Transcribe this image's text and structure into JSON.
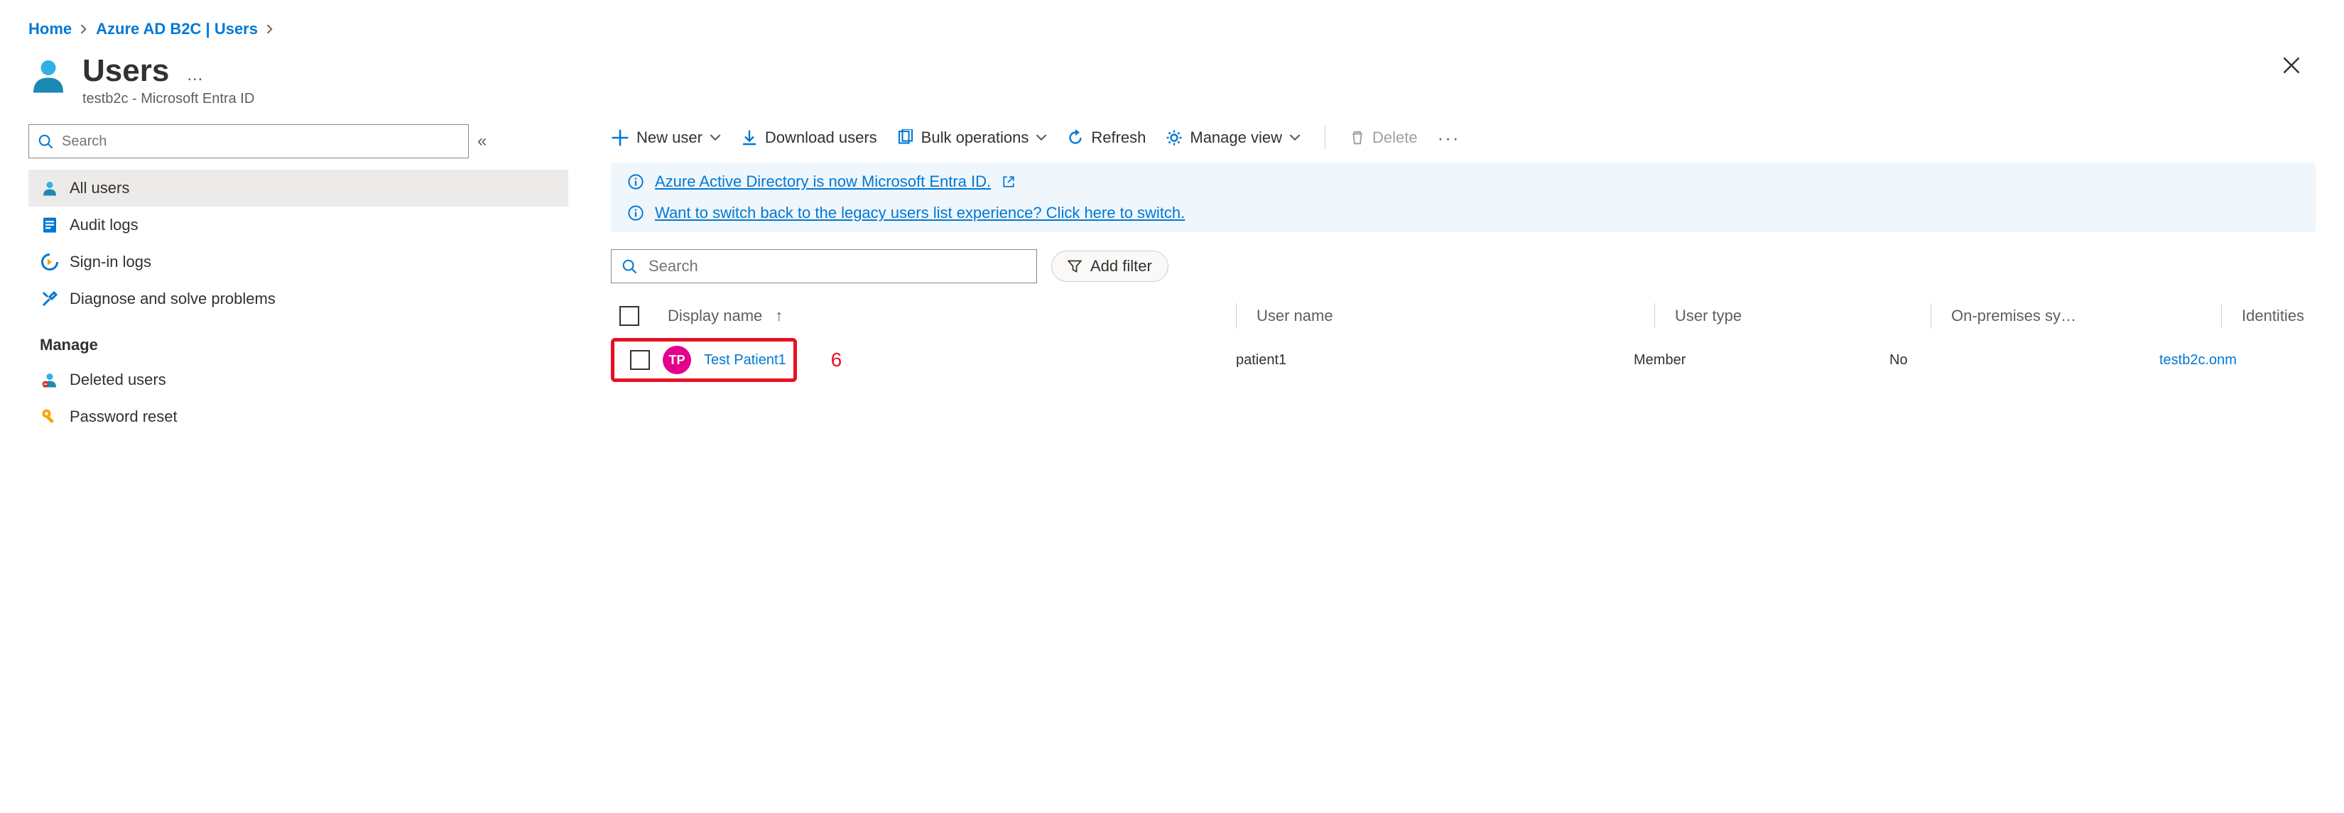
{
  "breadcrumb": {
    "home": "Home",
    "second": "Azure AD B2C | Users"
  },
  "header": {
    "title": "Users",
    "subtitle": "testb2c - Microsoft Entra ID"
  },
  "sidebar": {
    "search_placeholder": "Search",
    "items": [
      {
        "label": "All users"
      },
      {
        "label": "Audit logs"
      },
      {
        "label": "Sign-in logs"
      },
      {
        "label": "Diagnose and solve problems"
      }
    ],
    "group_label": "Manage",
    "manage_items": [
      {
        "label": "Deleted users"
      },
      {
        "label": "Password reset"
      }
    ]
  },
  "toolbar": {
    "new_user": "New user",
    "download": "Download users",
    "bulk": "Bulk operations",
    "refresh": "Refresh",
    "manage_view": "Manage view",
    "delete": "Delete"
  },
  "info": {
    "line1": "Azure Active Directory is now Microsoft Entra ID.",
    "line2": "Want to switch back to the legacy users list experience? Click here to switch."
  },
  "filter": {
    "search_placeholder": "Search",
    "add_filter": "Add filter"
  },
  "table": {
    "columns": {
      "display_name": "Display name",
      "user_name": "User name",
      "user_type": "User type",
      "on_prem": "On-premises sy…",
      "identities": "Identities"
    },
    "rows": [
      {
        "initials": "TP",
        "display_name": "Test Patient1",
        "user_name": "patient1",
        "user_type": "Member",
        "on_prem": "No",
        "identities": "testb2c.onm"
      }
    ]
  },
  "annotation": {
    "six": "6"
  }
}
